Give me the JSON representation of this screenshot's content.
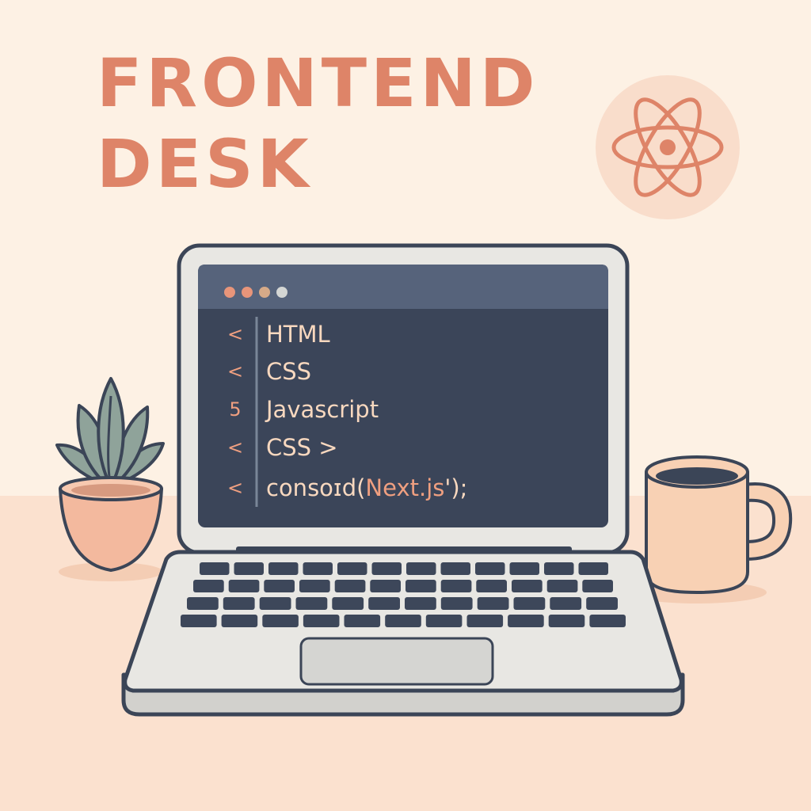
{
  "title": {
    "line1": "FRONTEND",
    "line2": "DESK"
  },
  "badge": {
    "icon": "react-atom-icon"
  },
  "editor": {
    "window_dots": [
      "#e8957a",
      "#e8957a",
      "#d6aa88",
      "#d4d6d4"
    ],
    "lines": [
      {
        "gutter": "<",
        "text": "HTML"
      },
      {
        "gutter": "<",
        "text": "CSS"
      },
      {
        "gutter": "5",
        "text": "Javascript"
      },
      {
        "gutter": "<",
        "text": "CSS >"
      },
      {
        "gutter": "<",
        "text_prefix": "consoɪd(",
        "text_highlight": "Next.js",
        "text_suffix": "');"
      }
    ]
  },
  "colors": {
    "background": "#fdf1e4",
    "desk": "#fbe1cf",
    "title": "#de8468",
    "badge_bg": "#f9ddcb",
    "outline": "#3b4557",
    "screen": "#3b4559",
    "screen_bar": "#56637b",
    "gutter_text": "#ef9f80",
    "code_text": "#f8d8bf",
    "laptop_body": "#e8e7e3",
    "keys": "#3d475a",
    "pot": "#f3b99e",
    "leaf": "#8fa39a",
    "mug": "#f8d1b4",
    "coffee": "#3b4557"
  }
}
